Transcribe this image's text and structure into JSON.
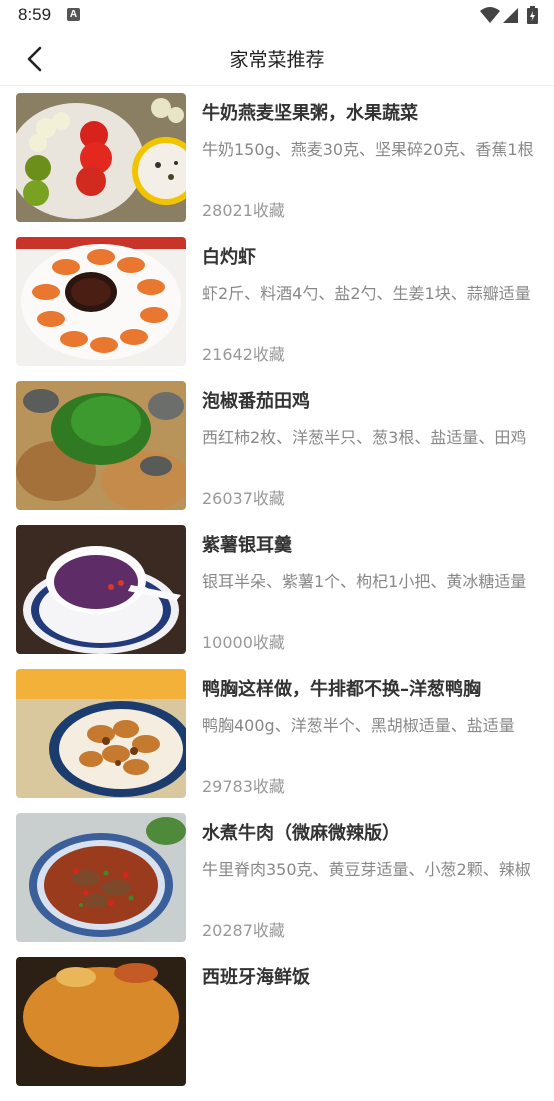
{
  "status": {
    "time": "8:59",
    "notif_letter": "A"
  },
  "toolbar": {
    "title": "家常菜推荐",
    "back_icon": "chevron-left-icon"
  },
  "recipes": [
    {
      "title": "牛奶燕麦坚果粥，水果蔬菜",
      "ingredients": "牛奶150g、燕麦30克、坚果碎20克、香蕉1根",
      "favorites": "28021收藏"
    },
    {
      "title": "白灼虾",
      "ingredients": "虾2斤、料酒4勺、盐2勺、生姜1块、蒜瓣适量",
      "favorites": "21642收藏"
    },
    {
      "title": "泡椒番茄田鸡",
      "ingredients": "西红柿2枚、洋葱半只、葱3根、盐适量、田鸡",
      "favorites": "26037收藏"
    },
    {
      "title": "紫薯银耳羹",
      "ingredients": "银耳半朵、紫薯1个、枸杞1小把、黄冰糖适量",
      "favorites": "10000收藏"
    },
    {
      "title": "鸭胸这样做，牛排都不换–洋葱鸭胸",
      "ingredients": "鸭胸400g、洋葱半个、黑胡椒适量、盐适量",
      "favorites": "29783收藏"
    },
    {
      "title": "水煮牛肉（微麻微辣版）",
      "ingredients": "牛里脊肉350克、黄豆芽适量、小葱2颗、辣椒",
      "favorites": "20287收藏"
    },
    {
      "title": "西班牙海鲜饭",
      "ingredients": "",
      "favorites": ""
    }
  ]
}
